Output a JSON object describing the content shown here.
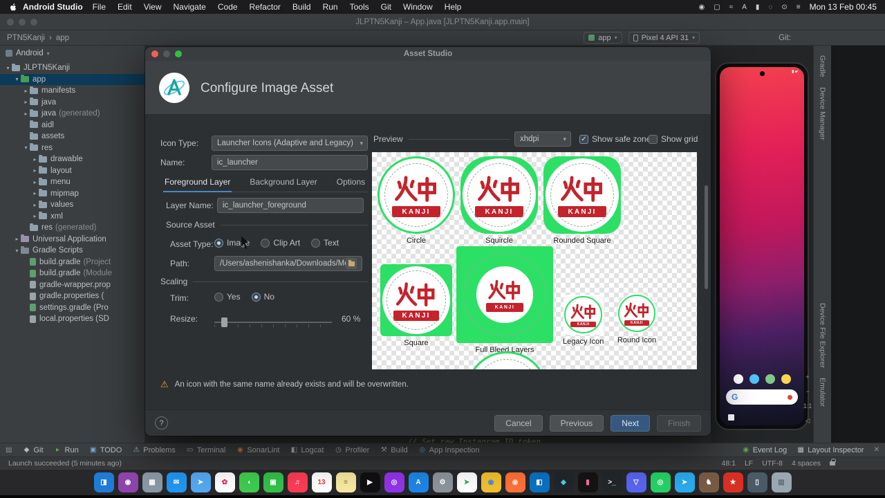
{
  "menu_bar": {
    "app_name": "Android Studio",
    "items": [
      "File",
      "Edit",
      "View",
      "Navigate",
      "Code",
      "Refactor",
      "Build",
      "Run",
      "Tools",
      "Git",
      "Window",
      "Help"
    ],
    "status_icons": [
      "◉",
      "▢",
      "≈",
      "A",
      "▮",
      "◌",
      "⊙",
      "≡"
    ],
    "clock": "Mon 13 Feb 00:45"
  },
  "ide": {
    "window_title": "JLPTN5Kanji – App.java [JLPTN5Kanji.app.main]",
    "breadcrumb": {
      "root": "PTN5Kanji",
      "sep": "›",
      "current": "app"
    },
    "toolbar": {
      "pre_icons": [
        {
          "g": "⚒",
          "fg": "#a8abad"
        }
      ],
      "run_config": "app",
      "device": "Pixel 4 API 31",
      "run_icons": [
        {
          "g": "▶",
          "fg": "#65a35c"
        },
        {
          "g": "↻",
          "fg": "#9a9da0"
        },
        {
          "g": "⬤",
          "fg": "#65a35c"
        },
        {
          "g": "◔",
          "fg": "#65a35c"
        },
        {
          "g": "■",
          "fg": "#9a9da0"
        }
      ],
      "git_label": "Git:",
      "git_icons": [
        {
          "g": "✓",
          "fg": "#4db6ac"
        },
        {
          "g": "↓",
          "fg": "#6fa8dc"
        },
        {
          "g": "↑",
          "fg": "#86b36f"
        }
      ],
      "end_icons": [
        {
          "g": "◌",
          "fg": "#a8abad"
        },
        {
          "g": "▦",
          "fg": "#a8abad"
        },
        {
          "g": "◉",
          "fg": "#a8abad"
        }
      ]
    },
    "project": {
      "panel_title": "Android",
      "tree": [
        {
          "arrow": "▾",
          "icon": "project",
          "label": "JLPTN5Kanji",
          "depth": 0
        },
        {
          "arrow": "▾",
          "icon": "app",
          "label": "app",
          "depth": 1,
          "selected": true
        },
        {
          "arrow": "▸",
          "icon": "manifest",
          "label": "manifests",
          "depth": 2
        },
        {
          "arrow": "▸",
          "icon": "java",
          "label": "java",
          "depth": 2
        },
        {
          "arrow": "▸",
          "icon": "java",
          "label": "java",
          "suffix": "(generated)",
          "depth": 2
        },
        {
          "icon": "folder",
          "label": "aidl",
          "depth": 2
        },
        {
          "icon": "folder",
          "label": "assets",
          "depth": 2
        },
        {
          "arrow": "▾",
          "icon": "res",
          "label": "res",
          "depth": 2
        },
        {
          "arrow": "▸",
          "icon": "folder",
          "label": "drawable",
          "depth": 3
        },
        {
          "arrow": "▸",
          "icon": "folder",
          "label": "layout",
          "depth": 3
        },
        {
          "arrow": "▸",
          "icon": "folder",
          "label": "menu",
          "depth": 3
        },
        {
          "arrow": "▸",
          "icon": "folder",
          "label": "mipmap",
          "depth": 3
        },
        {
          "arrow": "▸",
          "icon": "folder",
          "label": "values",
          "depth": 3
        },
        {
          "arrow": "▸",
          "icon": "folder",
          "label": "xml",
          "depth": 3
        },
        {
          "icon": "res",
          "label": "res",
          "suffix": "(generated)",
          "depth": 2
        },
        {
          "arrow": "▸",
          "icon": "universal",
          "label": "Universal Application",
          "depth": 1
        },
        {
          "arrow": "▾",
          "icon": "gradle",
          "label": "Gradle Scripts",
          "depth": 1
        },
        {
          "icon": "gradlefile",
          "label": "build.gradle",
          "suffix": "(Project",
          "depth": 2
        },
        {
          "icon": "gradlefile",
          "label": "build.gradle",
          "suffix": "(Module",
          "depth": 2
        },
        {
          "icon": "propfile",
          "label": "gradle-wrapper.prop",
          "depth": 2
        },
        {
          "icon": "propfile",
          "label": "gradle.properties (",
          "depth": 2
        },
        {
          "icon": "gradlefile",
          "label": "settings.gradle (Pro",
          "depth": 2
        },
        {
          "icon": "propfile",
          "label": "local.properties (SD",
          "depth": 2
        }
      ]
    },
    "right_tabs": [
      "Gradle",
      "Device Manager",
      "Device File Explorer",
      "Emulator"
    ],
    "emulator": {
      "zoom_controls": [
        "+",
        "−",
        "1:1",
        "◁"
      ],
      "screen_dots": [
        {
          "bg": "#ffffff"
        },
        {
          "bg": "#4fc3f7"
        },
        {
          "bg": "#81c784"
        },
        {
          "bg": "#ffd54f"
        }
      ]
    },
    "editor_peek": "// Set raw Instagram ID token",
    "tool_buttons": [
      {
        "g": "◆",
        "label": "Git",
        "fg": "#b9bcbe"
      },
      {
        "g": "▸",
        "label": "Run",
        "fg": "#65a35c"
      },
      {
        "g": "▣",
        "label": "TODO",
        "fg": "#6fa8dc"
      },
      {
        "g": "⚠",
        "label": "Problems",
        "fg": "#b9bcbe"
      },
      {
        "g": "▭",
        "label": "Terminal",
        "fg": "#b9bcbe"
      },
      {
        "g": "◉",
        "label": "SonarLint",
        "fg": "#d28445"
      },
      {
        "g": "◧",
        "label": "Logcat",
        "fg": "#b9bcbe"
      },
      {
        "g": "◷",
        "label": "Profiler",
        "fg": "#b9bcbe"
      },
      {
        "g": "⚒",
        "label": "Build",
        "fg": "#b9bcbe"
      },
      {
        "g": "◎",
        "label": "App Inspection",
        "fg": "#6fa8dc"
      }
    ],
    "status_right_buttons": [
      {
        "g": "◉",
        "label": "Event Log",
        "fg": "#65a35c"
      },
      {
        "g": "▦",
        "label": "Layout Inspector",
        "fg": "#b9bcbe"
      }
    ],
    "status": {
      "message": "Launch succeeded (5 minutes ago)",
      "cursor": "48:1",
      "line_sep": "LF",
      "encoding": "UTF-8",
      "indent": "4 spaces"
    }
  },
  "dialog": {
    "title": "Asset Studio",
    "heading": "Configure Image Asset",
    "form": {
      "icon_type_label": "Icon Type:",
      "icon_type_value": "Launcher Icons (Adaptive and Legacy)",
      "name_label": "Name:",
      "name_value": "ic_launcher",
      "tabs": [
        {
          "label": "Foreground Layer",
          "selected": true
        },
        {
          "label": "Background Layer"
        },
        {
          "label": "Options"
        }
      ],
      "layer_name_label": "Layer Name:",
      "layer_name_value": "ic_launcher_foreground",
      "source_asset_heading": "Source Asset",
      "asset_type_label": "Asset Type:",
      "asset_type_options": [
        {
          "label": "Image",
          "selected": true
        },
        {
          "label": "Clip Art"
        },
        {
          "label": "Text"
        }
      ],
      "path_label": "Path:",
      "path_value": "/Users/ashenishanka/Downloads/Moc",
      "scaling_heading": "Scaling",
      "trim_label": "Trim:",
      "trim_options": [
        {
          "label": "Yes"
        },
        {
          "label": "No",
          "selected": true
        }
      ],
      "resize_label": "Resize:",
      "resize_value": "60 %"
    },
    "preview": {
      "label": "Preview",
      "density": "xhdpi",
      "safe_zone_label": "Show safe zone",
      "safe_zone_checked": true,
      "grid_label": "Show grid",
      "grid_checked": false,
      "logo": {
        "kanji": "火中",
        "text": "KANJI"
      },
      "items": [
        {
          "cls": "circle",
          "label": "Circle"
        },
        {
          "cls": "squircle",
          "label": "Squircle"
        },
        {
          "cls": "rounded",
          "label": "Rounded Square"
        },
        {
          "cls": "square",
          "label": "Square"
        },
        {
          "cls": "fullbleed",
          "label": "Full Bleed Layers"
        },
        {
          "cls": "legacy",
          "label": "Legacy Icon"
        },
        {
          "cls": "round",
          "label": "Round Icon"
        },
        {
          "cls": "peek",
          "label": ""
        }
      ]
    },
    "warning_icon": "⚠",
    "warning": "An icon with the same name already exists and will be overwritten.",
    "help_label": "?",
    "buttons": {
      "cancel": "Cancel",
      "previous": "Previous",
      "next": "Next",
      "finish": "Finish"
    }
  },
  "dock": {
    "items": [
      {
        "g": "◨",
        "bg": "#1f7bd4"
      },
      {
        "g": "◉",
        "bg": "#8e44ad"
      },
      {
        "g": "▦",
        "bg": "#8a99a5"
      },
      {
        "g": "✉",
        "bg": "#2196f3"
      },
      {
        "g": "➤",
        "bg": "#54a9f2"
      },
      {
        "g": "✿",
        "bg": "#ffffff",
        "fg": "#e91e63"
      },
      {
        "g": "◖",
        "bg": "#3fcc4e"
      },
      {
        "g": "▣",
        "bg": "#35c04b"
      },
      {
        "g": "♫",
        "bg": "#fb3c55"
      },
      {
        "g": "13",
        "bg": "#ffffff",
        "fg": "#e53935"
      },
      {
        "g": "≡",
        "bg": "#f7e9a0",
        "fg": "#8a7a3a"
      },
      {
        "g": "▶",
        "bg": "#101012"
      },
      {
        "g": "◎",
        "bg": "#9333ea"
      },
      {
        "g": "A",
        "bg": "#1d86e8"
      },
      {
        "g": "⚙",
        "bg": "#8d959c"
      },
      {
        "g": "➤",
        "bg": "#ffffff",
        "fg": "#34a853"
      },
      {
        "g": "◉",
        "bg": "#f2c12e",
        "fg": "#4285f4"
      },
      {
        "g": "◉",
        "bg": "#ff7139",
        "fg": "#ffe3d3"
      },
      {
        "g": "◧",
        "bg": "#0a72c4"
      },
      {
        "g": "◆",
        "bg": "#20262b",
        "fg": "#4dd0e1"
      },
      {
        "g": "▮",
        "bg": "#141414",
        "fg": "#ff6e9c"
      },
      {
        "g": ">_",
        "bg": "#22272b"
      },
      {
        "g": "▽",
        "bg": "#5865f2"
      },
      {
        "g": "◎",
        "bg": "#25d366"
      },
      {
        "g": "➤",
        "bg": "#2aabee"
      },
      {
        "g": "♞",
        "bg": "#7a5c45"
      },
      {
        "g": "★",
        "bg": "#d93025"
      },
      {
        "g": "▯",
        "bg": "#4a5a66"
      },
      {
        "g": "▥",
        "bg": "#9aa7b1",
        "fg": "#5d6a73"
      }
    ]
  }
}
